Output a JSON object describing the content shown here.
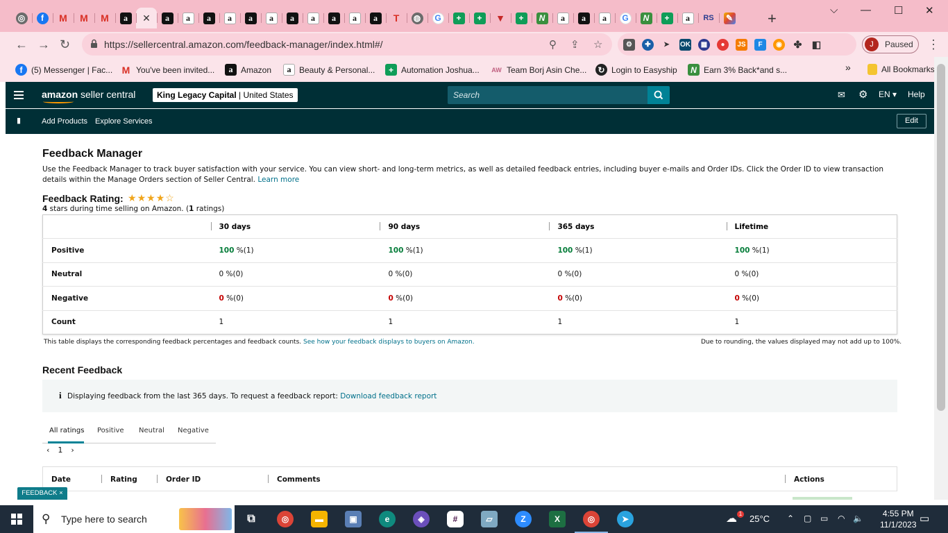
{
  "browser": {
    "tabs": [
      {
        "icon": "chrome-icon"
      },
      {
        "icon": "facebook-icon"
      },
      {
        "icon": "gmail-icon"
      },
      {
        "icon": "gmail-icon"
      },
      {
        "icon": "gmail-icon"
      },
      {
        "icon": "amazon-icon"
      },
      {
        "icon": "close-icon",
        "active": true
      },
      {
        "icon": "amazon-icon"
      },
      {
        "icon": "amazon-icon"
      },
      {
        "icon": "amazon-icon"
      },
      {
        "icon": "amazon-icon"
      },
      {
        "icon": "amazon-icon"
      },
      {
        "icon": "amazon-icon"
      },
      {
        "icon": "amazon-icon"
      },
      {
        "icon": "amazon-icon"
      },
      {
        "icon": "amazon-icon"
      },
      {
        "icon": "amazon-icon"
      },
      {
        "icon": "amazon-icon"
      },
      {
        "icon": "t-icon"
      },
      {
        "icon": "globe-icon"
      },
      {
        "icon": "google-icon"
      },
      {
        "icon": "sheets-icon"
      },
      {
        "icon": "sheets-icon"
      },
      {
        "icon": "red-v-icon"
      },
      {
        "icon": "sheets-icon"
      },
      {
        "icon": "lime-n-icon"
      },
      {
        "icon": "amazon-icon"
      },
      {
        "icon": "amazon-icon"
      },
      {
        "icon": "amazon-icon"
      },
      {
        "icon": "google-icon"
      },
      {
        "icon": "lime-n-icon"
      },
      {
        "icon": "sheets-icon"
      },
      {
        "icon": "amazon-icon"
      },
      {
        "icon": "rs-icon"
      },
      {
        "icon": "multi-icon"
      }
    ],
    "url": "https://sellercentral.amazon.com/feedback-manager/index.html#/",
    "profile": {
      "initial": "J",
      "status": "Paused"
    },
    "bookmarks": [
      {
        "label": "(5) Messenger | Fac...",
        "icon": "facebook-icon"
      },
      {
        "label": "You've been invited...",
        "icon": "gmail-icon"
      },
      {
        "label": "Amazon",
        "icon": "amazon-icon"
      },
      {
        "label": "Beauty & Personal...",
        "icon": "amazon-icon"
      },
      {
        "label": "Automation Joshua...",
        "icon": "sheets-icon"
      },
      {
        "label": "Team Borj Asin Che...",
        "icon": "logo-icon"
      },
      {
        "label": "Login to Easyship",
        "icon": "easyship-icon"
      },
      {
        "label": "Earn 3% Back*and s...",
        "icon": "lime-n-icon"
      }
    ],
    "more_bookmarks": "»",
    "all_bookmarks": "All Bookmarks"
  },
  "seller_central": {
    "logo_main": "amazon",
    "logo_sub": "seller central",
    "account_name": "King Legacy Capital",
    "account_region": "United States",
    "search_placeholder": "Search",
    "language": "EN",
    "help": "Help",
    "nav": {
      "add_products": "Add Products",
      "explore_services": "Explore Services",
      "edit": "Edit"
    }
  },
  "page": {
    "title": "Feedback Manager",
    "description": "Use the Feedback Manager to track buyer satisfaction with your service. You can view short- and long-term metrics, as well as detailed feedback entries, including buyer e-mails and Order IDs. Click the Order ID to view transaction details within the Manage Orders section of Seller Central.",
    "learn_more": "Learn more",
    "rating_title": "Feedback Rating:",
    "rating_stars": 4,
    "rating_max": 5,
    "rating_value": "4",
    "rating_text": "stars during time selling on Amazon.",
    "rating_count": "1",
    "rating_count_suffix": "ratings)",
    "table": {
      "columns": [
        "30 days",
        "90 days",
        "365 days",
        "Lifetime"
      ],
      "rows": [
        {
          "label": "Positive",
          "values": [
            "100",
            "100",
            "100",
            "100"
          ],
          "suffix": " %(1)"
        },
        {
          "label": "Neutral",
          "values": [
            "0",
            "0",
            "0",
            "0"
          ],
          "suffix": " %(0)"
        },
        {
          "label": "Negative",
          "values": [
            "0",
            "0",
            "0",
            "0"
          ],
          "suffix": " %(0)"
        },
        {
          "label": "Count",
          "values": [
            "1",
            "1",
            "1",
            "1"
          ],
          "suffix": ""
        }
      ]
    },
    "note_left": "This table displays the corresponding feedback percentages and feedback counts.",
    "note_link": "See how your feedback displays to buyers on Amazon.",
    "note_right": "Due to rounding, the values displayed may not add up to 100%.",
    "recent_title": "Recent Feedback",
    "info_text": "Displaying feedback from the last 365 days. To request a feedback report:",
    "info_link": "Download feedback report",
    "rating_tabs": [
      "All ratings",
      "Positive",
      "Neutral",
      "Negative"
    ],
    "page_number": "1",
    "recent_columns": [
      "Date",
      "Rating",
      "Order ID",
      "Comments",
      "Actions"
    ],
    "feedback_tag": "FEEDBACK ×"
  },
  "taskbar": {
    "search_placeholder": "Type here to search",
    "weather": "25°C",
    "weather_badge": "1",
    "time": "4:55 PM",
    "date": "11/1/2023"
  }
}
